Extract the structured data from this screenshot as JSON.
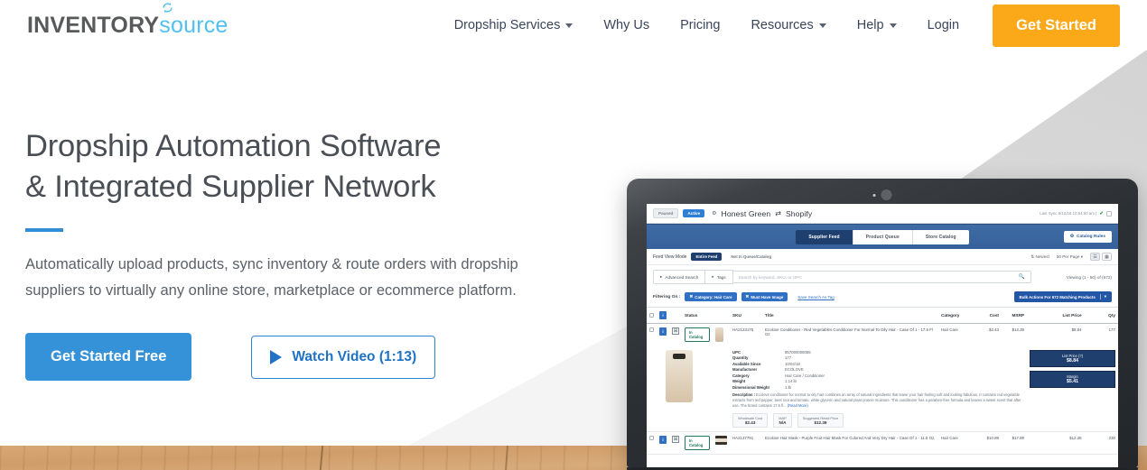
{
  "brand": {
    "part1": "INVENTORY",
    "part2": "source",
    "accent_blue": "#4fc0f0",
    "dark": "#58595b"
  },
  "header": {
    "nav": [
      {
        "label": "Dropship Services",
        "has_caret": true
      },
      {
        "label": "Why Us",
        "has_caret": false
      },
      {
        "label": "Pricing",
        "has_caret": false
      },
      {
        "label": "Resources",
        "has_caret": true
      },
      {
        "label": "Help",
        "has_caret": true
      },
      {
        "label": "Login",
        "has_caret": false
      }
    ],
    "cta": "Get Started",
    "cta_color": "#fba919"
  },
  "hero": {
    "title_line1": "Dropship Automation Software",
    "title_line2": "& Integrated Supplier Network",
    "accent_rule_color": "#2f8ed6",
    "subtitle": "Automatically upload products, sync inventory & route orders with dropship suppliers to virtually any online store, marketplace or ecommerce platform.",
    "primary_cta": "Get Started Free",
    "secondary_cta": "Watch Video (1:13)",
    "primary_color": "#3592d8"
  },
  "app": {
    "status_paused": "Paused",
    "status_active": "Active",
    "store_title": "Honest Green",
    "swap_glyph": "⇄",
    "platform": "Shopify",
    "last_sync": "Last Sync 9/12/18 10:54:50 am |",
    "tabs": [
      {
        "label": "Supplier Feed",
        "active": true
      },
      {
        "label": "Product Queue",
        "active": false
      },
      {
        "label": "Store Catalog",
        "active": false
      }
    ],
    "catalog_rules": "Catalog Rules",
    "feed_view_mode_label": "Feed View Mode",
    "feed_mode_active": "Entire Feed",
    "feed_mode_other": "Not In Queue/Catalog",
    "sort_label": "Newest",
    "per_page_label": "50 Per Page",
    "advanced_search": "Advanced Search",
    "tags_label": "Tags",
    "search_placeholder": "Search by keyword, SKU, or UPC",
    "viewing": "Viewing (1 - 50) of (672)",
    "filtering_label": "Filtering On :",
    "filter_chips": [
      "Category: Hair Care",
      "Must Have Image"
    ],
    "save_search": "Save Search As Tag",
    "bulk_actions": "Bulk Actions For 672 Matching Products",
    "columns": [
      "Status",
      "SKU",
      "Title",
      "Category",
      "Cost",
      "MSRP",
      "List Price",
      "Qty"
    ],
    "rows": [
      {
        "status": "In Catalog",
        "sku": "HA2123175",
        "title": "Ecolove Conditioner - Red Vegetables Conditioner For Normal To Oily Hair - Case Of 1 - 17.6 Fl Oz",
        "category": "Hair Care",
        "cost": "$2.43",
        "msrp": "$12.39",
        "list_price": "$8.84",
        "qty": "177"
      },
      {
        "status": "In Catalog",
        "sku": "HA2137791",
        "title": "Ecolove Hair Mask - Purple Fruit Hair Mask For Colored And Very Dry Hair - Case Of 1 - 11.8 Oz.",
        "category": "Hair Care",
        "cost": "$10.89",
        "msrp": "$17.89",
        "list_price": "$12.38",
        "qty": "230"
      }
    ],
    "detail": {
      "specs": [
        {
          "key": "UPC",
          "value": "857090006055"
        },
        {
          "key": "Quantity",
          "value": "177"
        },
        {
          "key": "Available Since",
          "value": "10/04/18"
        },
        {
          "key": "Manufacturer",
          "value": "ECOLOVE"
        },
        {
          "key": "Category",
          "value": "Hair Care / Conditioner"
        },
        {
          "key": "Weight",
          "value": "1.14 lb"
        },
        {
          "key": "Dimensional Weight",
          "value": "1 lb"
        }
      ],
      "description_label": "Description :",
      "description": "Ecolove conditioner for normal to oily hair combines an array of natural ingredients that leave your hair feeling soft and looking fabulous. It contains red vegetable extracts from red pepper, beet root and tomato, white glycerin and natural plant protein moisture. This conditioner has a paraben-free formula and leaves a sweet scent that after use. The brand contains 17.6 fl...",
      "read_more": "(Read More)",
      "price_cells": [
        {
          "key": "Wholesale Cost",
          "value": "$2.43"
        },
        {
          "key": "MAP",
          "value": "N/A"
        },
        {
          "key": "Suggested Retail Price",
          "value": "$12.39"
        }
      ],
      "list_price_box": {
        "key": "List Price (?)",
        "value": "$8.84"
      },
      "margin_box": {
        "key": "Margin",
        "value": "$5.41"
      }
    }
  }
}
